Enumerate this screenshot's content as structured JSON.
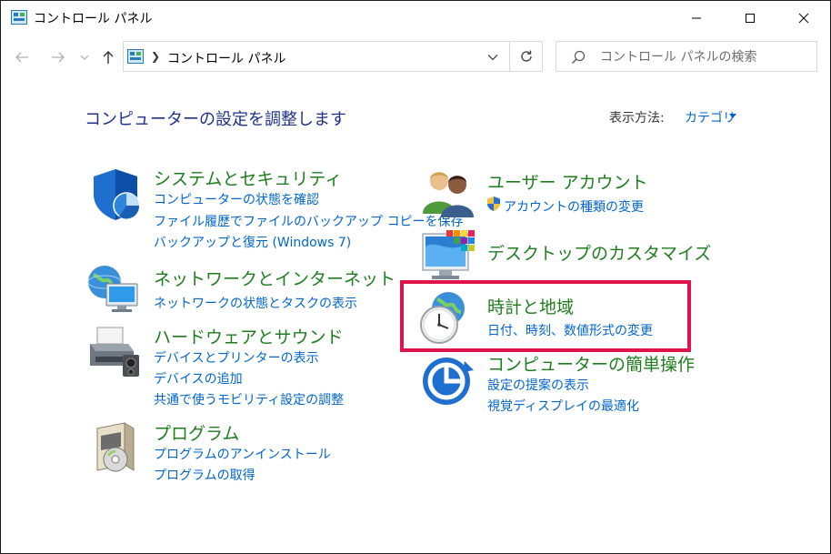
{
  "window": {
    "title": "コントロール パネル"
  },
  "nav": {
    "address": "コントロール パネル",
    "search_placeholder": "コントロール パネルの検索"
  },
  "main": {
    "heading": "コンピューターの設定を調整します",
    "view_by_label": "表示方法:",
    "view_by_value": "カテゴリ"
  },
  "categories": {
    "system": {
      "title": "システムとセキュリティ",
      "links": [
        "コンピューターの状態を確認",
        "ファイル履歴でファイルのバックアップ コピーを保存",
        "バックアップと復元 (Windows 7)"
      ]
    },
    "network": {
      "title": "ネットワークとインターネット",
      "links": [
        "ネットワークの状態とタスクの表示"
      ]
    },
    "hardware": {
      "title": "ハードウェアとサウンド",
      "links": [
        "デバイスとプリンターの表示",
        "デバイスの追加",
        "共通で使うモビリティ設定の調整"
      ]
    },
    "programs": {
      "title": "プログラム",
      "links": [
        "プログラムのアンインストール",
        "プログラムの取得"
      ]
    },
    "users": {
      "title": "ユーザー アカウント",
      "links": [
        "アカウントの種類の変更"
      ]
    },
    "appearance": {
      "title": "デスクトップのカスタマイズ",
      "links": []
    },
    "clock": {
      "title": "時計と地域",
      "links": [
        "日付、時刻、数値形式の変更"
      ]
    },
    "ease": {
      "title": "コンピューターの簡単操作",
      "links": [
        "設定の提案の表示",
        "視覚ディスプレイの最適化"
      ]
    }
  },
  "colors": {
    "heading": "#1e3287",
    "category_title": "#1e7e1e",
    "link": "#0066cc",
    "highlight": "#e0134a"
  }
}
